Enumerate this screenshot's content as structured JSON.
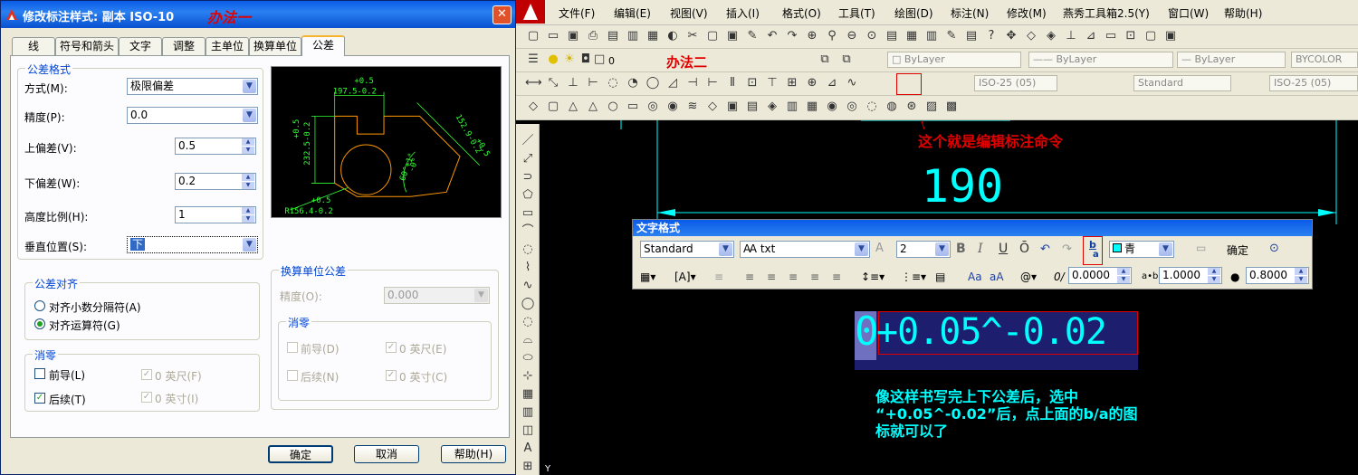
{
  "dialog": {
    "title": "修改标注样式: 副本 ISO-10",
    "annotation": "办法一",
    "close_icon": "✕",
    "tabs": [
      "线",
      "符号和箭头",
      "文字",
      "调整",
      "主单位",
      "换算单位",
      "公差"
    ],
    "active_tab": "公差",
    "tolerance_format": {
      "group_label": "公差格式",
      "method_label": "方式(M):",
      "method_value": "极限偏差",
      "precision_label": "精度(P):",
      "precision_value": "0.0",
      "upper_label": "上偏差(V):",
      "upper_value": "0.5",
      "lower_label": "下偏差(W):",
      "lower_value": "0.2",
      "height_label": "高度比例(H):",
      "height_value": "1",
      "vpos_label": "垂直位置(S):",
      "vpos_value": "下"
    },
    "tolerance_align": {
      "group_label": "公差对齐",
      "opt1": "对齐小数分隔符(A)",
      "opt2": "对齐运算符(G)"
    },
    "zero_suppress": {
      "group_label": "消零",
      "leading": "前导(L)",
      "trailing": "后续(T)",
      "feet": "0 英尺(F)",
      "inches": "0 英寸(I)"
    },
    "alt_units": {
      "group_label": "换算单位公差",
      "precision_label": "精度(O):",
      "precision_value": "0.000",
      "zero_group_label": "消零",
      "leading": "前导(D)",
      "trailing": "后续(N)",
      "feet": "0 英尺(E)",
      "inches": "0 英寸(C)"
    },
    "preview": {
      "top_tol": "+0.5",
      "top_dim": "197.5-0.2",
      "left_tol": "+0.5",
      "left_dim": "232.5-0.2",
      "right_tol": "+0.5",
      "right_dim": "152.9-0.2",
      "angle": "60°+1°",
      "angle2": "-0°",
      "bottom_tol": "+0.5",
      "bottom_dim": "R156.4-0.2"
    },
    "buttons": {
      "ok": "确定",
      "cancel": "取消",
      "help": "帮助(H)"
    }
  },
  "cad": {
    "menus": [
      "文件(F)",
      "编辑(E)",
      "视图(V)",
      "插入(I)",
      "格式(O)",
      "工具(T)",
      "绘图(D)",
      "标注(N)",
      "修改(M)",
      "燕秀工具箱2.5(Y)",
      "窗口(W)",
      "帮助(H)"
    ],
    "annotation2": "办法二",
    "layer_value": "0",
    "bylayer1": "ByLayer",
    "bylayer2": "ByLayer",
    "bylayer3": "ByLayer",
    "bycolor": "BYCOLOR",
    "dimstyle1": "ISO-25 (05)",
    "textstyle": "Standard",
    "dimstyle2": "ISO-25 (05)",
    "edit_dim_note": "这个就是编辑标注命令",
    "dimension_value": "190",
    "text_format": {
      "title": "文字格式",
      "style": "Standard",
      "font": "txt",
      "height": "2",
      "bold": "B",
      "italic": "I",
      "underline": "U",
      "overline": "Ō",
      "stack_top": "b",
      "stack_bottom": "a",
      "color": "青",
      "ok": "确定",
      "oblique": "0.0000",
      "tracking": "1.0000",
      "width": "0.8000"
    },
    "edit_text": {
      "prefix": "0",
      "stack": "+0.05^-0.02"
    },
    "instruction": [
      "像这样书写完上下公差后，选中",
      "“+0.05^-0.02”后，点上面的b/a的图",
      "标就可以了"
    ],
    "ucs_label": "Y"
  },
  "colors": {
    "accent_red": "#e00000",
    "cyan": "#00ffff",
    "preview_green": "#33ff33",
    "preview_orange": "#ff9900"
  }
}
